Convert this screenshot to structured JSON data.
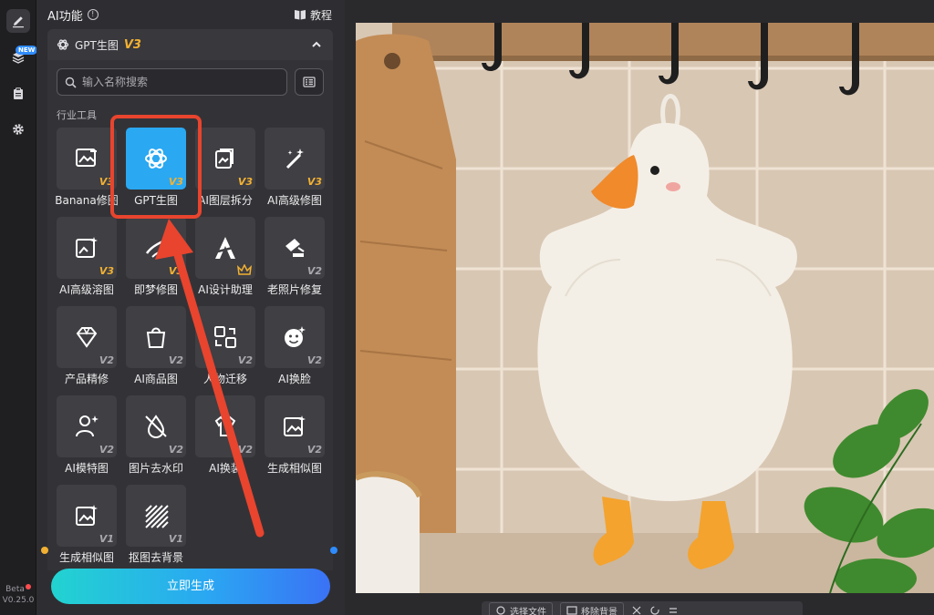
{
  "sidebar": {
    "items": [
      {
        "icon": "pen-icon",
        "active": true
      },
      {
        "icon": "layers-icon",
        "badge": "NEW"
      },
      {
        "icon": "clipboard-icon"
      },
      {
        "icon": "gear-icon"
      }
    ],
    "beta_label": "Beta",
    "version": "V0.25.0"
  },
  "panel": {
    "title": "AI功能",
    "info_icon": "info-icon",
    "tutorial_label": "教程",
    "section": {
      "title": "GPT生图",
      "version": "V3"
    },
    "search": {
      "placeholder": "输入名称搜索"
    },
    "category": "行业工具",
    "tools": [
      {
        "label": "Banana修图",
        "version": "V3",
        "icon": "image-edit-icon"
      },
      {
        "label": "GPT生图",
        "version": "V3",
        "icon": "openai-icon",
        "selected": true
      },
      {
        "label": "AI图层拆分",
        "version": "V3",
        "icon": "layer-split-icon"
      },
      {
        "label": "AI高级修图",
        "version": "V3",
        "icon": "magic-wand-icon"
      },
      {
        "label": "AI高级溶图",
        "version": "V3",
        "icon": "image-sparkle-icon"
      },
      {
        "label": "即梦修图",
        "version": "V3",
        "icon": "brush-icon"
      },
      {
        "label": "AI设计助理",
        "version": "",
        "icon": "design-assistant-icon",
        "crown": true
      },
      {
        "label": "老照片修复",
        "version": "V2",
        "icon": "photo-repair-icon"
      },
      {
        "label": "产品精修",
        "version": "V2",
        "icon": "diamond-icon"
      },
      {
        "label": "AI商品图",
        "version": "V2",
        "icon": "shopping-bag-icon"
      },
      {
        "label": "人物迁移",
        "version": "V2",
        "icon": "person-swap-icon"
      },
      {
        "label": "AI换脸",
        "version": "V2",
        "icon": "face-icon"
      },
      {
        "label": "AI模特图",
        "version": "V2",
        "icon": "model-icon"
      },
      {
        "label": "图片去水印",
        "version": "V2",
        "icon": "watermark-remove-icon"
      },
      {
        "label": "AI换装",
        "version": "V2",
        "icon": "clothes-icon"
      },
      {
        "label": "生成相似图",
        "version": "V2",
        "icon": "similar-image-icon"
      },
      {
        "label": "生成相似图",
        "version": "V1",
        "icon": "similar-image-icon"
      },
      {
        "label": "抠图去背景",
        "version": "V1",
        "icon": "cutout-icon"
      }
    ],
    "generate_label": "立即生成"
  },
  "toolbar": {
    "select_file_label": "选择文件",
    "remove_bg_label": "移除背景"
  },
  "colors": {
    "accent": "#2aa8f2",
    "highlight": "#e8442e",
    "version_gold": "#f2b132"
  }
}
